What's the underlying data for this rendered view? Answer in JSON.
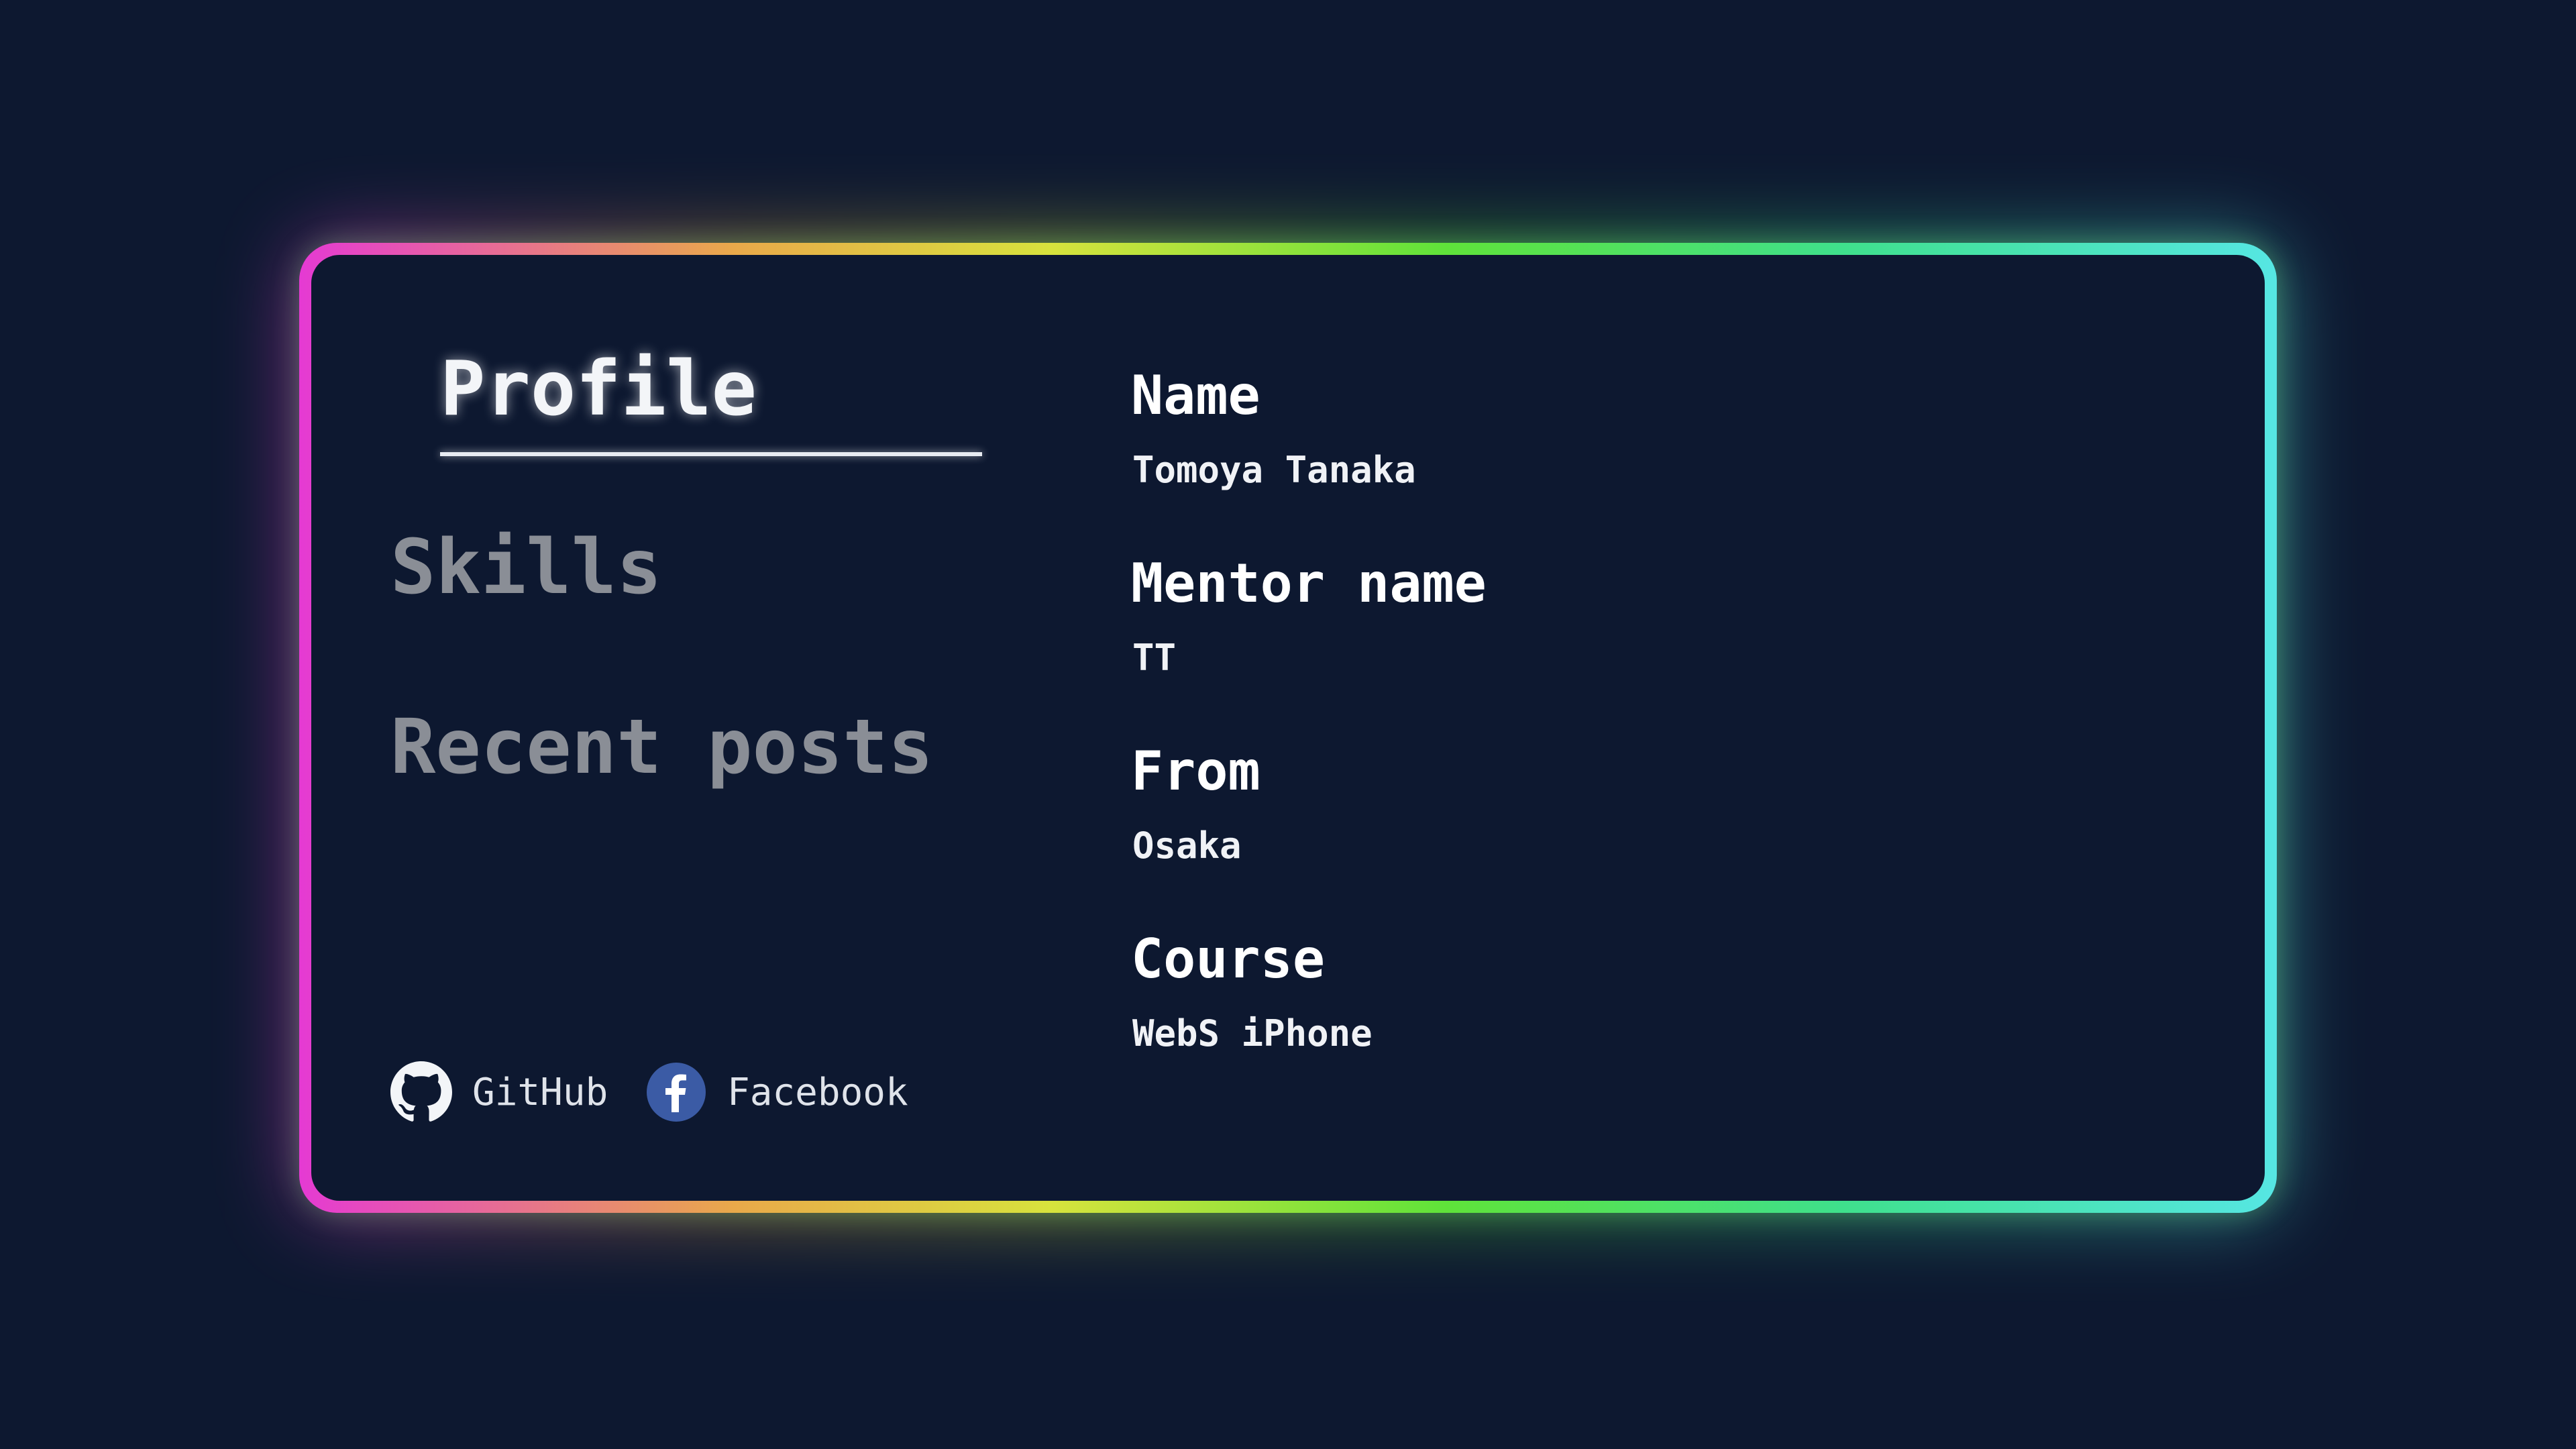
{
  "theme": {
    "background": "#0d1830",
    "frame_gradient": [
      "#e53ad3",
      "#e9a94a",
      "#d7e23d",
      "#5fe23a",
      "#3fe08c",
      "#56e6e3"
    ],
    "active_text": "#f3f5f8",
    "inactive_text": "#8a8e96"
  },
  "nav": {
    "items": [
      {
        "label": "Profile",
        "active": true
      },
      {
        "label": "Skills",
        "active": false
      },
      {
        "label": "Recent posts",
        "active": false
      }
    ]
  },
  "social": [
    {
      "label": "GitHub",
      "icon": "github-icon"
    },
    {
      "label": "Facebook",
      "icon": "facebook-icon"
    }
  ],
  "profile": {
    "fields": [
      {
        "label": "Name",
        "value": "Tomoya Tanaka"
      },
      {
        "label": "Mentor name",
        "value": "TT"
      },
      {
        "label": "From",
        "value": "Osaka"
      },
      {
        "label": "Course",
        "value": "WebS iPhone"
      }
    ]
  }
}
